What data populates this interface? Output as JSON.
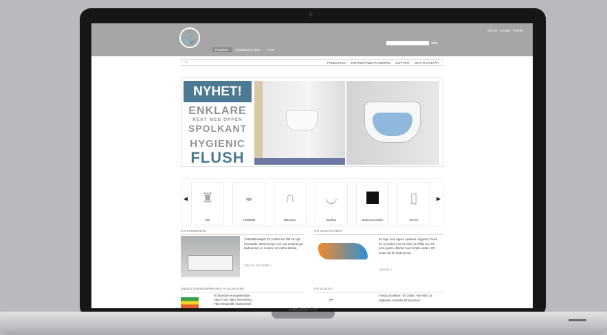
{
  "laptop": {
    "brand": "MacBook Pro"
  },
  "header": {
    "logo_glyph": "⚓",
    "top_links": "Om Ifö · Kontakt · Partner",
    "search_placeholder": "",
    "search_button": "SÖK",
    "nav": [
      "Produkter",
      "Inspiration & Ideer",
      "Hem"
    ]
  },
  "crumb": {
    "home_glyph": "⌂",
    "nav": [
      "PRODUKTER",
      "INSPIRERANDE PLANERING",
      "SUPPORT",
      "OM IFÖ SANITÄR"
    ]
  },
  "hero": {
    "badge": "NYHET!",
    "line1": "ENKLARE",
    "line2": "RENT MED ÖPPEN",
    "line3": "SPOLKANT",
    "line4": "HYGIENIC",
    "line5": "FLUSH"
  },
  "carousel": {
    "prev": "◀",
    "next": "▶",
    "items": [
      {
        "label": "WC",
        "icon": "toilet-icon",
        "glyph": "♜"
      },
      {
        "label": "Tvättställ",
        "icon": "washbasin-icon",
        "glyph": "◒"
      },
      {
        "label": "Blandare",
        "icon": "faucet-icon",
        "glyph": "∩"
      },
      {
        "label": "Badkar",
        "icon": "bathtub-icon",
        "glyph": "◡"
      },
      {
        "label": "Badrumsmöbler",
        "icon": "cabinet-icon",
        "glyph": ""
      },
      {
        "label": "Dusch",
        "icon": "shower-icon",
        "glyph": "▯"
      }
    ]
  },
  "news": {
    "left_heading": "IFÖ FORMSPRÅK",
    "left_text": "Tvättställsskåpet Ifö Caribia har fått ett nytt formspråk. Stilrena linjer och nya material ger badrummet en modern och tidlös känsla.",
    "left_link": "Läs mer om Caribia »",
    "right_heading": "IFÖ SPOLAR RENT",
    "right_text": "Ifö Sign med öppen spolkant, Hygienic Flush. En ny toalett som är enkel att hålla ren och som spolar effektivt med mindre vatten. Ett smart val för badrummet.",
    "right_link": "Läs mer »"
  },
  "bottom": {
    "left_heading": "ENKELT ENERGIMÄRKNING AV BLANDARE",
    "bullets": [
      "Ifö blandare energiklassade",
      "Klass A ger lägre förbrukning",
      "Välj energisnålt i badrummet"
    ],
    "right_heading": "IFÖ OUTLET",
    "right_text": "Fynda produkter i Ifö Outlet. Här hittar du utgående modeller till bra priser."
  }
}
